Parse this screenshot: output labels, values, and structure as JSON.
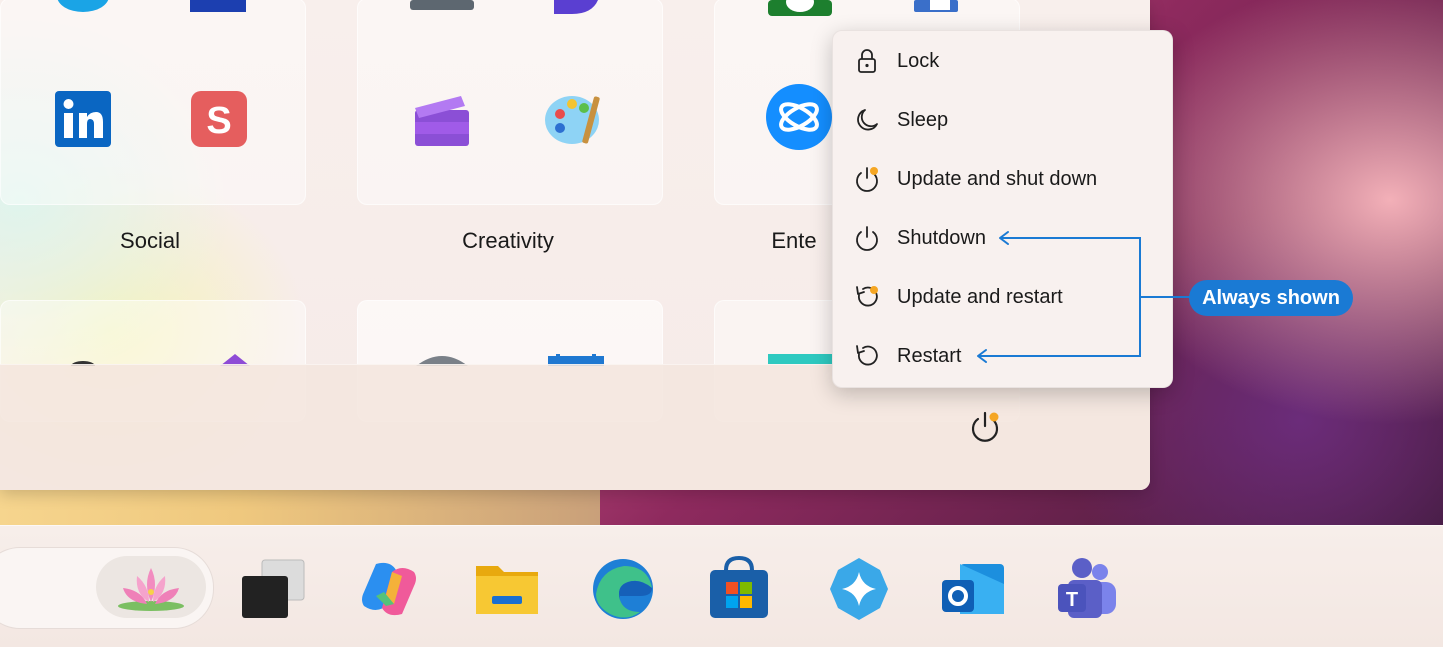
{
  "folders": [
    {
      "label": "Social"
    },
    {
      "label": "Creativity"
    },
    {
      "label": "Ente"
    }
  ],
  "power_menu": {
    "items": [
      {
        "label": "Lock",
        "icon": "lock-icon"
      },
      {
        "label": "Sleep",
        "icon": "moon-icon"
      },
      {
        "label": "Update and shut down",
        "icon": "power-update-icon"
      },
      {
        "label": "Shutdown",
        "icon": "power-icon"
      },
      {
        "label": "Update and restart",
        "icon": "restart-update-icon"
      },
      {
        "label": "Restart",
        "icon": "restart-icon"
      }
    ]
  },
  "callout": {
    "label": "Always shown",
    "color": "#1a7ad4"
  },
  "power_button": {
    "icon": "power-icon",
    "badge_color": "#f5a623"
  },
  "taskbar": {
    "items": [
      {
        "name": "search-lotus",
        "icon": "lotus-icon"
      },
      {
        "name": "task-view",
        "icon": "task-view-icon"
      },
      {
        "name": "copilot",
        "icon": "copilot-icon"
      },
      {
        "name": "file-explorer",
        "icon": "folder-icon"
      },
      {
        "name": "edge",
        "icon": "edge-icon"
      },
      {
        "name": "store",
        "icon": "store-icon"
      },
      {
        "name": "copilot-pro",
        "icon": "sparkle-icon"
      },
      {
        "name": "outlook",
        "icon": "outlook-icon"
      },
      {
        "name": "teams",
        "icon": "teams-icon"
      }
    ]
  }
}
